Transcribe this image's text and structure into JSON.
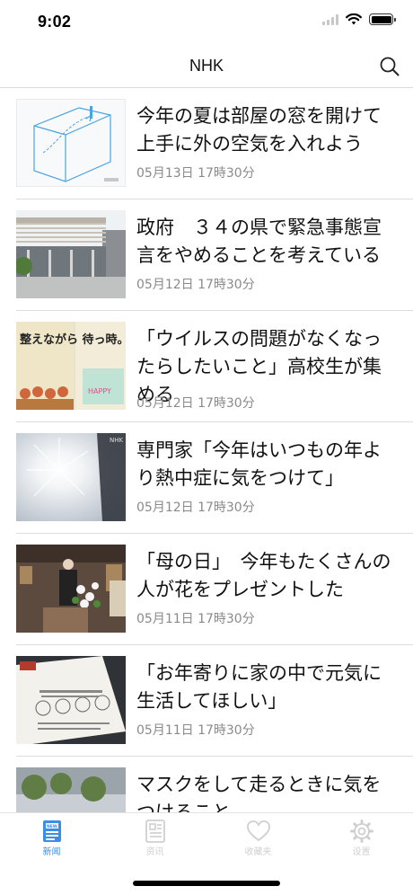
{
  "status_bar": {
    "time": "9:02"
  },
  "nav": {
    "title": "NHK"
  },
  "news": [
    {
      "title": "今年の夏は部屋の窓を開けて上手に外の空気を入れよう",
      "date": "05月13日 17時30分"
    },
    {
      "title": "政府　３４の県で緊急事態宣言をやめることを考えている",
      "date": "05月12日 17時30分"
    },
    {
      "title": "「ウイルスの問題がなくなったらしたいこと」高校生が集める",
      "date": "05月12日 17時30分",
      "thumb_text": "整えながら 待っ時。"
    },
    {
      "title": "専門家「今年はいつもの年より熱中症に気をつけて」",
      "date": "05月12日 17時30分",
      "thumb_text": "NHK"
    },
    {
      "title": "「母の日」　今年もたくさんの人が花をプレゼントした",
      "date": "05月11日 17時30分"
    },
    {
      "title": "「お年寄りに家の中で元気に生活してほしい」",
      "date": "05月11日 17時30分"
    },
    {
      "title": "マスクをして走るときに気をつけること",
      "date": ""
    }
  ],
  "tabs": [
    {
      "label": "新闻",
      "icon": "newspaper-icon",
      "active": true
    },
    {
      "label": "资讯",
      "icon": "info-list-icon",
      "active": false
    },
    {
      "label": "收藏夹",
      "icon": "heart-icon",
      "active": false
    },
    {
      "label": "设置",
      "icon": "gear-icon",
      "active": false
    }
  ],
  "colors": {
    "accent": "#3a8ee6",
    "inactive": "#d0d0d0",
    "date": "#8a8a8a"
  }
}
